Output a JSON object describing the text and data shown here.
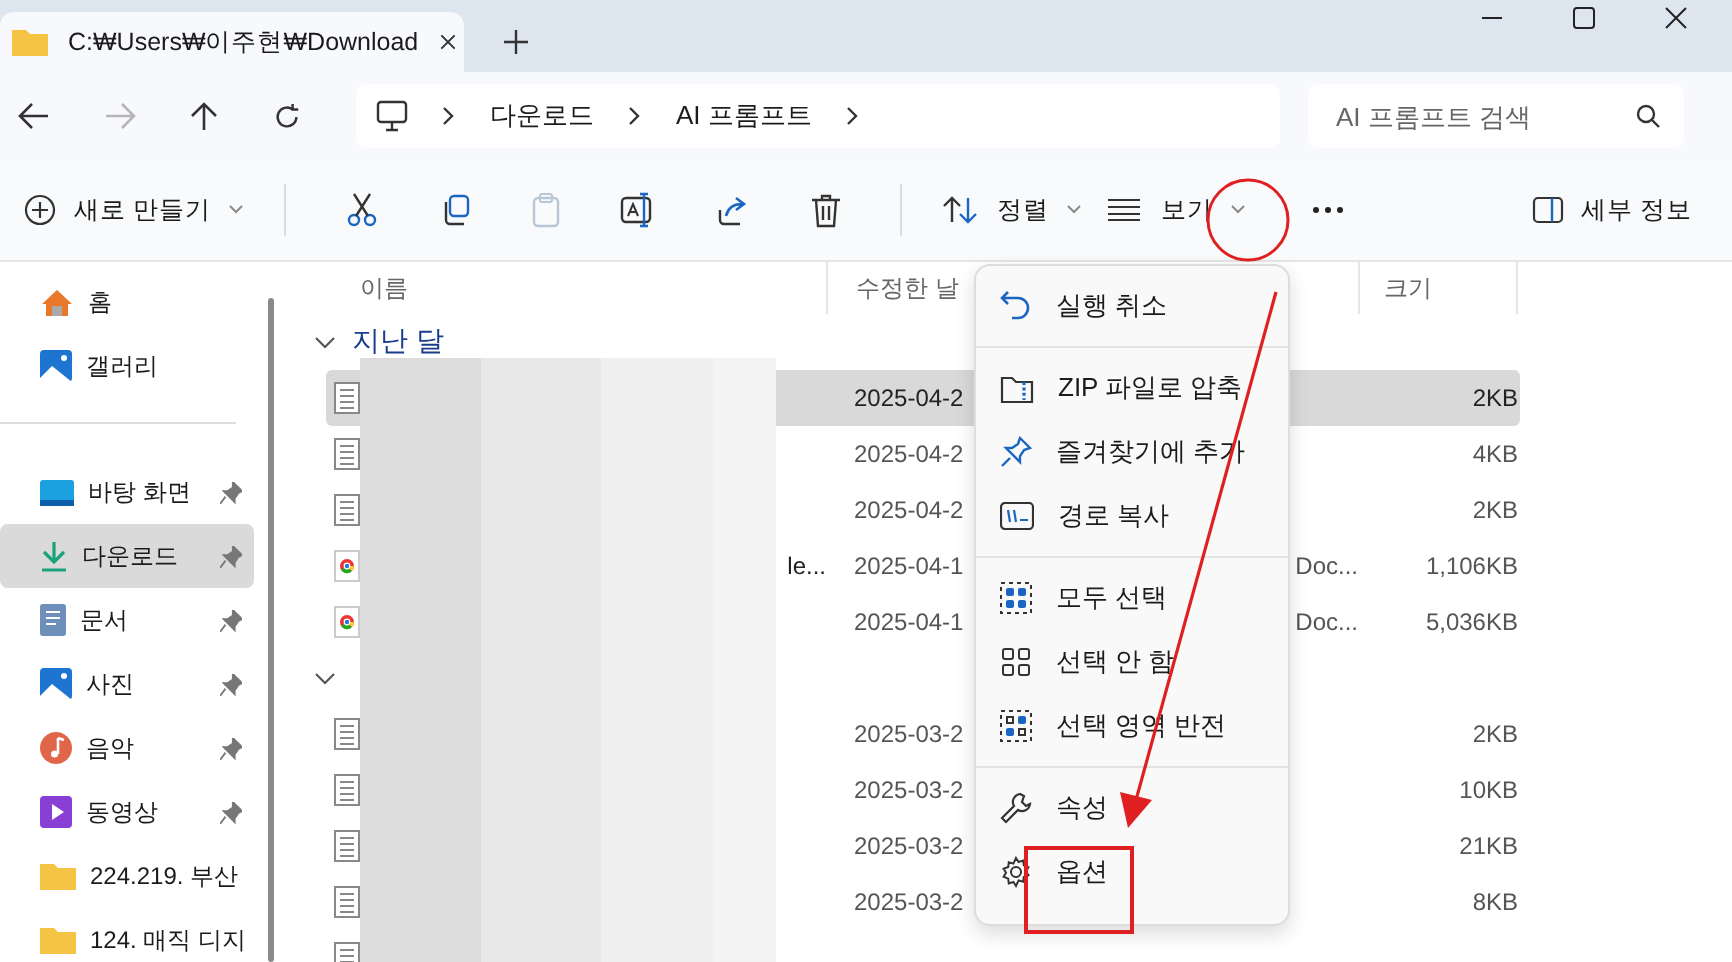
{
  "tab": {
    "title": "C:₩Users₩이주현₩Download"
  },
  "nav": {
    "back_disabled": false,
    "forward_disabled": true
  },
  "breadcrumb": [
    "다운로드",
    "AI 프롬프트"
  ],
  "search": {
    "placeholder": "AI 프롬프트 검색"
  },
  "toolbar": {
    "new_label": "새로 만들기",
    "paste_disabled": true,
    "sort_label": "정렬",
    "view_label": "보기",
    "details_label": "세부 정보"
  },
  "sidebar": {
    "top": [
      {
        "label": "홈",
        "kind": "home"
      },
      {
        "label": "갤러리",
        "kind": "gallery"
      }
    ],
    "items": [
      {
        "label": "바탕 화면",
        "kind": "desktop",
        "pinned": true,
        "selected": false
      },
      {
        "label": "다운로드",
        "kind": "download",
        "pinned": true,
        "selected": true
      },
      {
        "label": "문서",
        "kind": "documents",
        "pinned": true,
        "selected": false
      },
      {
        "label": "사진",
        "kind": "pictures",
        "pinned": true,
        "selected": false
      },
      {
        "label": "음악",
        "kind": "music",
        "pinned": true,
        "selected": false
      },
      {
        "label": "동영상",
        "kind": "videos",
        "pinned": true,
        "selected": false
      },
      {
        "label": "224.219. 부산",
        "kind": "folder",
        "selected": false
      },
      {
        "label": "124. 매직 디지",
        "kind": "folder",
        "selected": false
      }
    ]
  },
  "table": {
    "columns": [
      "이름",
      "수정한 날",
      "크기"
    ],
    "groups": [
      {
        "label": "지난 달",
        "rows": [
          {
            "kind": "text",
            "date": "2025-04-2",
            "size": "2KB",
            "selected": true
          },
          {
            "kind": "text",
            "date": "2025-04-2",
            "size": "4KB",
            "selected": false
          },
          {
            "kind": "text",
            "date": "2025-04-2",
            "size": "2KB",
            "selected": false
          },
          {
            "kind": "web",
            "name": "le...",
            "date": "2025-04-1",
            "type": "Doc...",
            "size": "1,106KB",
            "selected": false
          },
          {
            "kind": "web",
            "date": "2025-04-1",
            "type": "Doc...",
            "size": "5,036KB",
            "selected": false
          }
        ]
      },
      {
        "rows": [
          {
            "kind": "text",
            "date": "2025-03-2",
            "size": "2KB",
            "selected": false
          },
          {
            "kind": "text",
            "date": "2025-03-2",
            "size": "10KB",
            "selected": false
          },
          {
            "kind": "text",
            "date": "2025-03-2",
            "size": "21KB",
            "selected": false
          },
          {
            "kind": "text",
            "date": "2025-03-2",
            "size": "8KB",
            "selected": false
          },
          {
            "kind": "text",
            "selected": false
          }
        ]
      }
    ]
  },
  "menu": {
    "items": [
      {
        "kind": "item",
        "label": "실행 취소"
      },
      {
        "kind": "separator"
      },
      {
        "kind": "item",
        "label": "ZIP 파일로 압축"
      },
      {
        "kind": "item",
        "label": "즐겨찾기에 추가"
      },
      {
        "kind": "item",
        "label": "경로 복사"
      },
      {
        "kind": "separator"
      },
      {
        "kind": "item",
        "label": "모두 선택"
      },
      {
        "kind": "item",
        "label": "선택 안 함"
      },
      {
        "kind": "item",
        "label": "선택 영역 반전"
      },
      {
        "kind": "separator"
      },
      {
        "kind": "item",
        "label": "속성"
      },
      {
        "kind": "item",
        "label": "옵션"
      }
    ]
  }
}
